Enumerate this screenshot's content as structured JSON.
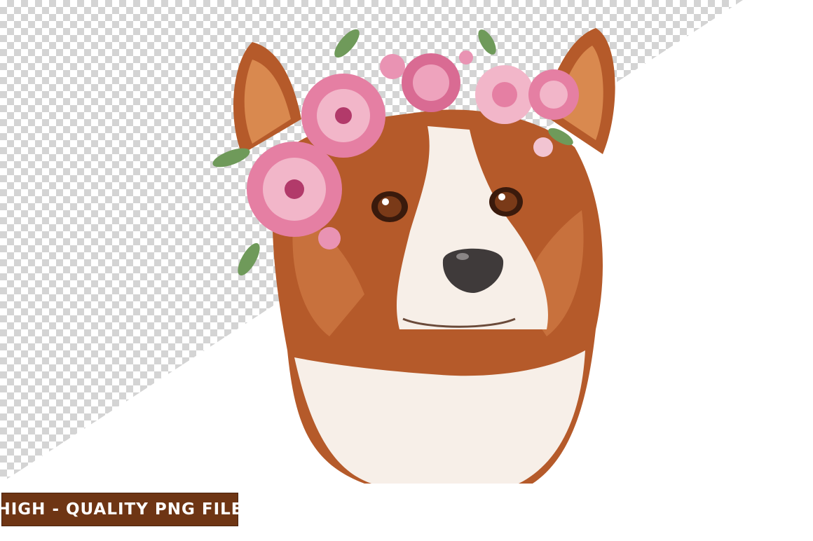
{
  "badge": {
    "text": "HIGH - QUALITY PNG FILE"
  },
  "palette": {
    "fur": "#b55a2a",
    "fur_light": "#d9894f",
    "white_fur": "#f7efe8",
    "flower_pink": "#e57fa3",
    "flower_light": "#f2b6c9",
    "leaf": "#6f9a5a",
    "badge_bg": "#6e3514"
  },
  "illustration": {
    "subject": "corgi-with-flower-crown"
  }
}
